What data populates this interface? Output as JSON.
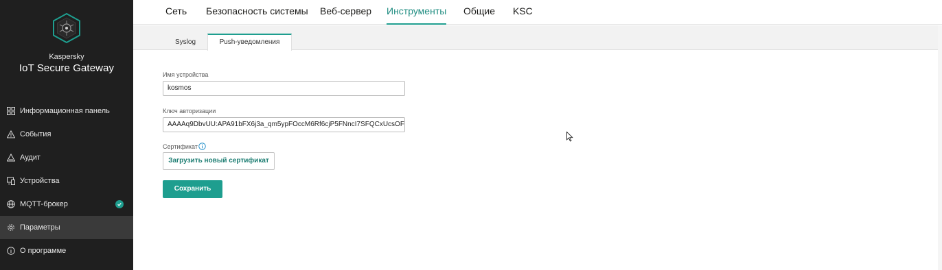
{
  "app": {
    "brand_small": "Kaspersky",
    "brand_big": "IoT Secure Gateway",
    "accent_color": "#1e9e8f",
    "sidebar_bg": "#1f1f1f"
  },
  "sidebar": {
    "items": [
      {
        "label": "Информационная панель",
        "icon": "dashboard-icon"
      },
      {
        "label": "События",
        "icon": "warning-icon"
      },
      {
        "label": "Аудит",
        "icon": "audit-icon"
      },
      {
        "label": "Устройства",
        "icon": "devices-icon"
      },
      {
        "label": "MQTT-брокер",
        "icon": "globe-icon",
        "status": "ok"
      },
      {
        "label": "Параметры",
        "icon": "gear-icon",
        "active": true
      },
      {
        "label": "О программе",
        "icon": "info-icon"
      }
    ]
  },
  "top_tabs": [
    {
      "label": "Сеть"
    },
    {
      "label": "Безопасность системы"
    },
    {
      "label": "Веб-сервер"
    },
    {
      "label": "Инструменты",
      "active": true
    },
    {
      "label": "Общие"
    },
    {
      "label": "KSC"
    }
  ],
  "sub_tabs": [
    {
      "label": "Syslog"
    },
    {
      "label": "Push-уведомления",
      "active": true
    }
  ],
  "form": {
    "device_name_label": "Имя устройства",
    "device_name_value": "kosmos",
    "auth_key_label": "Ключ авторизации",
    "auth_key_value": "AAAAq9DbvUU:APA91bFX6j3a_qm5ypFOccM6Rf6cjP5FNncI7SFQCxUcsOFw'",
    "certificate_label": "Сертификат",
    "upload_button": "Загрузить новый сертификат",
    "save_button": "Сохранить"
  }
}
